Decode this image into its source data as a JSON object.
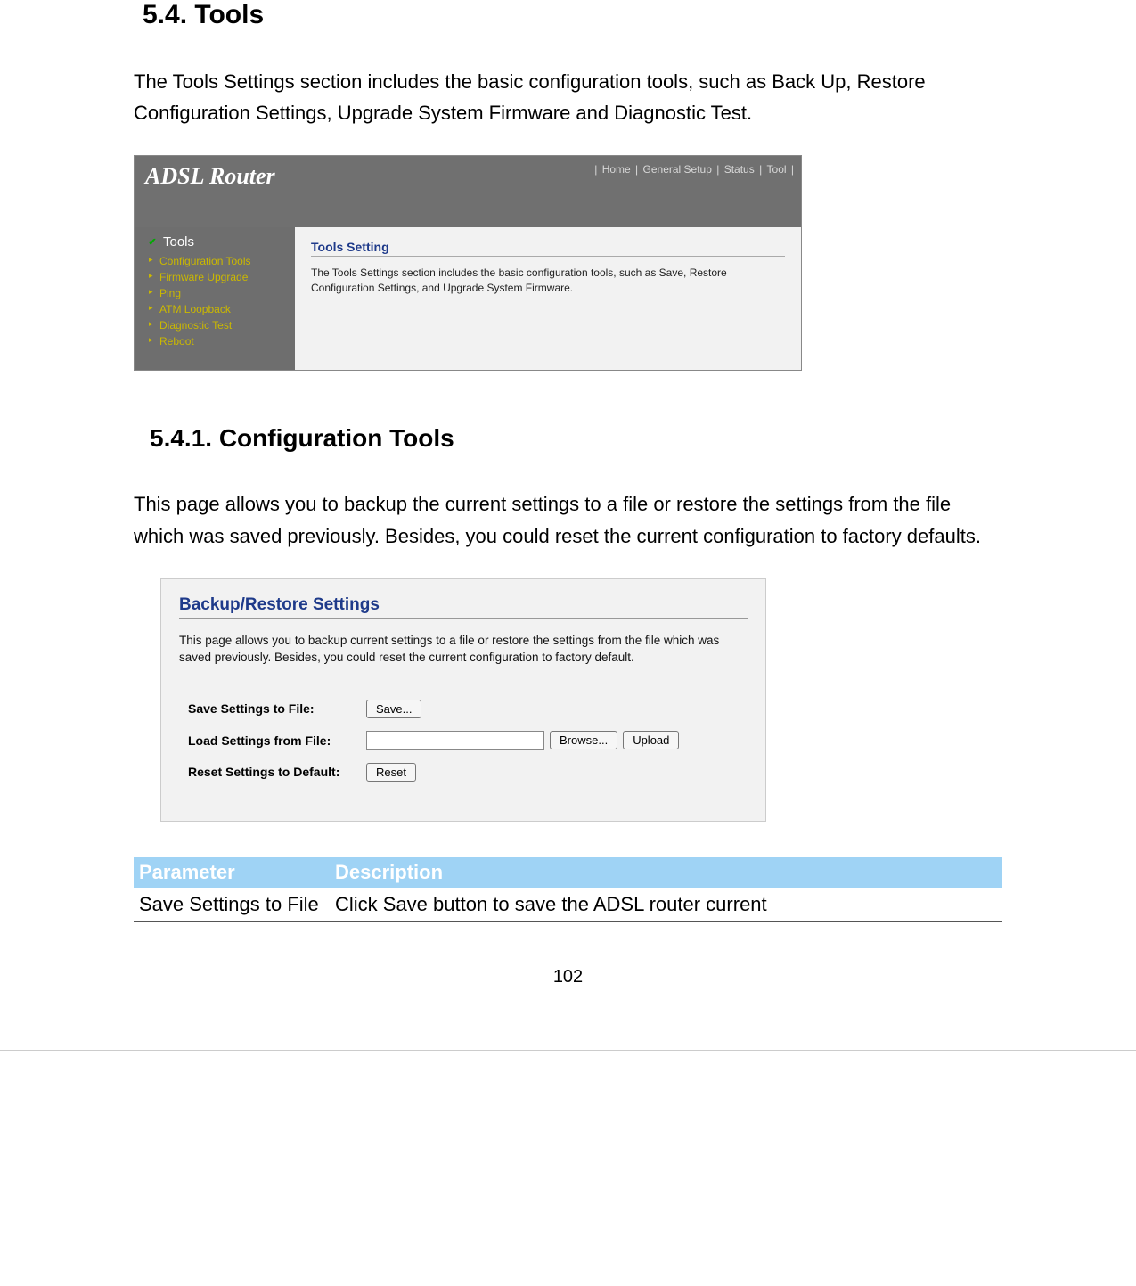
{
  "section": {
    "heading": "5.4.    Tools",
    "intro": "The Tools Settings section includes the basic configuration tools, such as Back Up, Restore Configuration Settings, Upgrade System Firmware and Diagnostic Test."
  },
  "router_shot": {
    "brand": "ADSL Router",
    "nav": [
      "Home",
      "General Setup",
      "Status",
      "Tool"
    ],
    "sidebar_top": "Tools",
    "sidebar_items": [
      "Configuration Tools",
      "Firmware Upgrade",
      "Ping",
      "ATM Loopback",
      "Diagnostic Test",
      "Reboot"
    ],
    "pane_title": "Tools Setting",
    "pane_text": "The Tools Settings section includes the basic configuration tools, such as Save, Restore Configuration Settings, and Upgrade System Firmware."
  },
  "subsection": {
    "heading": "5.4.1.      Configuration Tools",
    "intro": "This page allows you to backup the current settings to a file or restore the settings from the file which was saved previously. Besides, you could reset the current configuration to factory defaults."
  },
  "backup_shot": {
    "title": "Backup/Restore Settings",
    "text": "This page allows you to backup current settings to a file or restore the settings from the file which was saved previously. Besides, you could reset the current configuration to factory default.",
    "rows": {
      "save_label": "Save Settings to File:",
      "save_btn": "Save...",
      "load_label": "Load Settings from File:",
      "browse_btn": "Browse...",
      "upload_btn": "Upload",
      "reset_label": "Reset Settings to Default:",
      "reset_btn": "Reset"
    }
  },
  "table": {
    "col1": "Parameter",
    "col2": "Description",
    "row1_param": "Save Settings to File",
    "row1_desc": "Click Save button to save the ADSL router current"
  },
  "page_number": "102"
}
